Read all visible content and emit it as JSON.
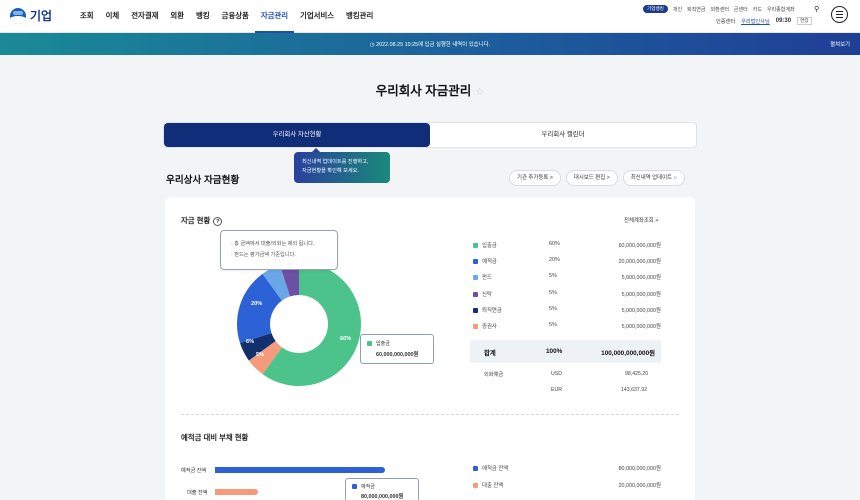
{
  "header": {
    "logo_text": "기업",
    "nav": [
      "조회",
      "이체",
      "전자결재",
      "외환",
      "뱅킹",
      "금융상품",
      "자금관리",
      "기업서비스",
      "뱅킹관리"
    ],
    "active_nav": 6,
    "util_pill": "기업뱅킹",
    "util_links": [
      "개인",
      "퇴직연금",
      "외환센터",
      "큰센터",
      "카드",
      "우리종합계좌"
    ],
    "login_label": "인증센터",
    "user_link": "우리법인사님",
    "timer": "09:30",
    "extend": "연장"
  },
  "notice": {
    "text": "2022.08.25 10:25에 입금 실행한 내역이 있습니다.",
    "right": "펼쳐보기"
  },
  "page": {
    "title": "우리회사 자금관리",
    "tabs": [
      "우리회사 자산현황",
      "우리회사 캘린더"
    ],
    "active_tab": 0,
    "tooltip_line1": "최신내역 업데이트를 진행하고,",
    "tooltip_line2": "자금현황을 확인해 보세요.",
    "section_title": "우리상사 자금현황",
    "buttons": [
      "기관 추가등록 >",
      "대시보드 편집 >",
      "최신내역 업데이트 ○"
    ]
  },
  "fund": {
    "title": "자금 현황",
    "more": "전체계좌조회 >",
    "notes": [
      "· 총 금액에서 대출/외화는 제외 됩니다.",
      "· 펀드는 평가금액 기준입니다."
    ],
    "callout_name": "입출금",
    "callout_amount": "60,000,000,000원",
    "items": [
      {
        "name": "입출금",
        "pct": "60%",
        "amount": "60,000,000,000원",
        "color": "#4cc38a",
        "value": 60
      },
      {
        "name": "예적금",
        "pct": "20%",
        "amount": "20,000,000,000원",
        "color": "#2d62d6",
        "value": 20
      },
      {
        "name": "펀드",
        "pct": "5%",
        "amount": "5,000,000,000원",
        "color": "#6aa7e8",
        "value": 5
      },
      {
        "name": "신탁",
        "pct": "5%",
        "amount": "5,000,000,000원",
        "color": "#6d4fa3",
        "value": 5
      },
      {
        "name": "퇴직연금",
        "pct": "5%",
        "amount": "5,000,000,000원",
        "color": "#12306e",
        "value": 5
      },
      {
        "name": "증권사",
        "pct": "5%",
        "amount": "5,000,000,000원",
        "color": "#f59a7a",
        "value": 5
      }
    ],
    "donut_labels": [
      "60%",
      "20%",
      "6%",
      "5%"
    ],
    "total_label": "합계",
    "total_pct": "100%",
    "total_amount": "100,000,000,000원",
    "fx_label": "외화예금",
    "fx": [
      {
        "cur": "USD",
        "amount": "98,425.20"
      },
      {
        "cur": "EUR",
        "amount": "143,637.92"
      }
    ]
  },
  "debt": {
    "title": "예적금 대비 부채 현황",
    "bars": [
      {
        "label": "예적금 잔액",
        "value": 80000000000,
        "color": "#2d62d6"
      },
      {
        "label": "대출 잔액",
        "value": 20000000000,
        "color": "#f59a7a"
      }
    ],
    "callout_name": "예적금",
    "callout_amount": "80,000,000,000원",
    "legend": [
      {
        "name": "예적금 잔액",
        "amount": "80,000,000,000원",
        "color": "#2d62d6"
      },
      {
        "name": "대출 잔액",
        "amount": "20,000,000,000원",
        "color": "#f59a7a"
      }
    ]
  }
}
